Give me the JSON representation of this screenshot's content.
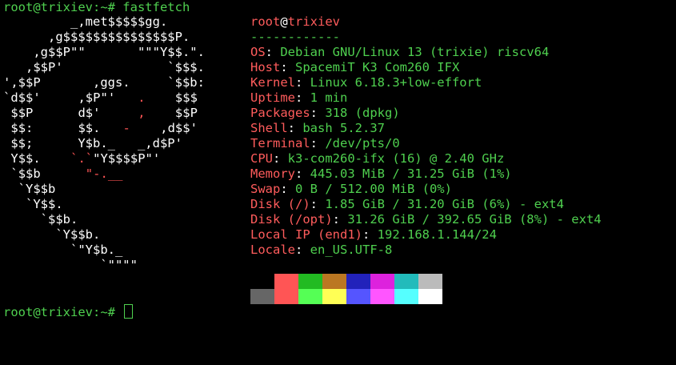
{
  "terminal": {
    "command_prompt": "root@trixiev:~# fastfetch",
    "final_prompt": "root@trixiev:~# "
  },
  "logo": {
    "lines": [
      "         _,met$$$$$gg.",
      "      ,g$$$$$$$$$$$$$$$P.",
      "    ,g$$P\"\"       \"\"\"Y$$.\".",
      "   ,$$P'              `$$$.",
      "',$$P       ,ggs.     `$$b:",
      "`d$$'     ,$P\"'   .    $$$",
      " $$P      d$'     ,    $$P",
      " $$:      $$.   -    ,d$$'",
      " $$;      Y$b._   _,d$P'",
      " Y$$.    `.`\"Y$$$$P\"'",
      " `$$b      \"-.__",
      "  `Y$$b",
      "   `Y$$.",
      "     `$$b.",
      "       `Y$$b.",
      "         `\"Y$b._",
      "             `\"\"\"\""
    ]
  },
  "header": {
    "user": "root",
    "at": "@",
    "host": "trixiev",
    "dashes": "------------"
  },
  "info": [
    {
      "key": "OS",
      "value": "Debian GNU/Linux 13 (trixie) riscv64"
    },
    {
      "key": "Host",
      "value": "SpacemiT K3 Com260 IFX"
    },
    {
      "key": "Kernel",
      "value": "Linux 6.18.3+low-effort"
    },
    {
      "key": "Uptime",
      "value": "1 min"
    },
    {
      "key": "Packages",
      "value": "318 (dpkg)"
    },
    {
      "key": "Shell",
      "value": "bash 5.2.37"
    },
    {
      "key": "Terminal",
      "value": "/dev/pts/0"
    },
    {
      "key": "CPU",
      "value": "k3-com260-ifx (16) @ 2.40 GHz"
    },
    {
      "key": "Memory",
      "value": "445.03 MiB / 31.25 GiB (1%)"
    },
    {
      "key": "Swap",
      "value": "0 B / 512.00 MiB (0%)"
    },
    {
      "key": "Disk (/)",
      "value": "1.85 GiB / 31.20 GiB (6%) - ext4"
    },
    {
      "key": "Disk (/opt)",
      "value": "31.26 GiB / 392.65 GiB (8%) - ext4"
    },
    {
      "key": "Local IP (end1)",
      "value": "192.168.1.144/24"
    },
    {
      "key": "Locale",
      "value": "en_US.UTF-8"
    }
  ],
  "palette": {
    "normal": [
      "#000000",
      "#ff5555",
      "#22bb22",
      "#bb7722",
      "#2222bb",
      "#dd22dd",
      "#22bbbb",
      "#bbbbbb"
    ],
    "bright": [
      "#666666",
      "#ff5555",
      "#55ff55",
      "#ffff55",
      "#5555ff",
      "#ff55ff",
      "#55ffff",
      "#ffffff"
    ]
  }
}
